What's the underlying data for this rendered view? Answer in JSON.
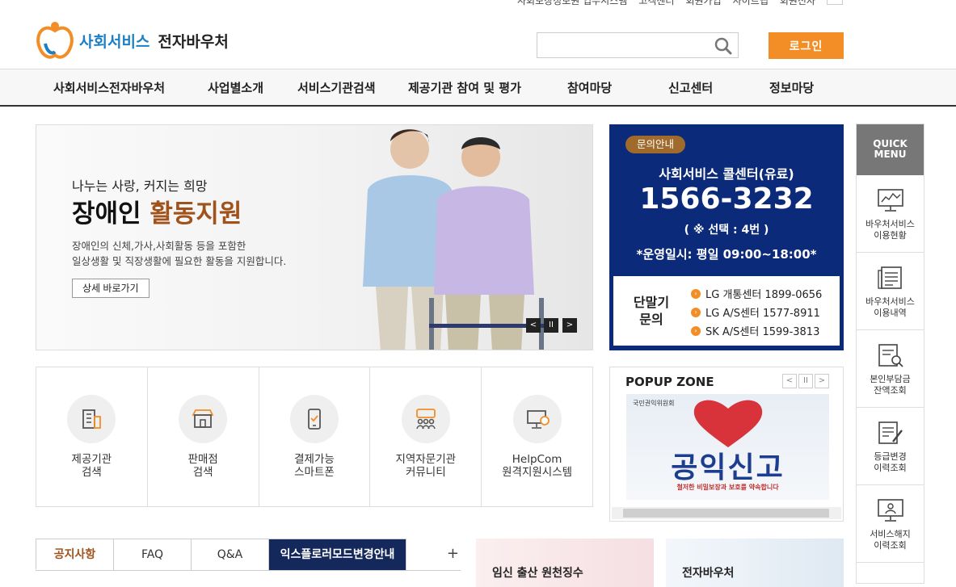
{
  "util": {
    "items": [
      "사회보장정보원 업무시스템",
      "고객센터",
      "회원가입",
      "사이트맵",
      "회원전자"
    ]
  },
  "header": {
    "logo_blue": "사회서비스",
    "logo_dark": "전자바우처",
    "search_placeholder": "",
    "login_label": "로그인"
  },
  "gnb": {
    "items": [
      "사회서비스전자바우처",
      "사업별소개",
      "서비스기관검색",
      "제공기관 참여 및 평가",
      "참여마당",
      "신고센터",
      "정보마당"
    ]
  },
  "visual": {
    "subtitle": "나누는 사랑, 커지는 희망",
    "title_plain": "장애인",
    "title_highlight": "활동지원",
    "desc_line1": "장애인의 신체,가사,사회활동 등을 포함한",
    "desc_line2": "일상생활 및 직장생활에 필요한 활동을 지원합니다.",
    "more_label": "상세 바로가기",
    "ctrl_prev": "<",
    "ctrl_pause": "II",
    "ctrl_next": ">"
  },
  "call": {
    "badge": "문의안내",
    "line1": "사회서비스 콜센터(유료)",
    "phone": "1566-3232",
    "line3": "( ※ 선택 : 4번 )",
    "line4": "*운영일시: 평일 09:00~18:00*",
    "terminal_label_1": "단말기",
    "terminal_label_2": "문의",
    "rows": [
      "LG 개통센터 1899-0656",
      "LG A/S센터 1577-8911",
      "SK A/S센터 1599-3813"
    ]
  },
  "quick": {
    "title_1": "QUICK",
    "title_2": "MENU",
    "items": [
      {
        "l1": "바우처서비스",
        "l2": "이용현황"
      },
      {
        "l1": "바우처서비스",
        "l2": "이용내역"
      },
      {
        "l1": "본인부담금",
        "l2": "잔액조회"
      },
      {
        "l1": "등급변경",
        "l2": "이력조회"
      },
      {
        "l1": "서비스해지",
        "l2": "이력조회"
      }
    ]
  },
  "services": [
    {
      "l1": "제공기관",
      "l2": "검색"
    },
    {
      "l1": "판매점",
      "l2": "검색"
    },
    {
      "l1": "결제가능",
      "l2": "스마트폰"
    },
    {
      "l1": "지역자문기관",
      "l2": "커뮤니티"
    },
    {
      "l1": "HelpCom",
      "l2": "원격지원시스템"
    }
  ],
  "popup": {
    "title": "POPUP ZONE",
    "image_org": "국민권익위원회",
    "image_big": "공익신고",
    "image_small": "철저한 비밀보장과 보호를 약속합니다",
    "btn_prev": "<",
    "btn_pause": "II",
    "btn_next": ">"
  },
  "tabs": {
    "items": [
      "공지사항",
      "FAQ",
      "Q&A",
      "익스플로러모드변경안내"
    ],
    "plus": "+"
  },
  "banners": {
    "b1": "임신 출산 원천징수",
    "b2": "전자바우처"
  },
  "colors": {
    "accent_orange": "#f28e25",
    "navy": "#0c2a7a",
    "brand_blue": "#1b7fc4",
    "highlight_brown": "#a0521b"
  }
}
